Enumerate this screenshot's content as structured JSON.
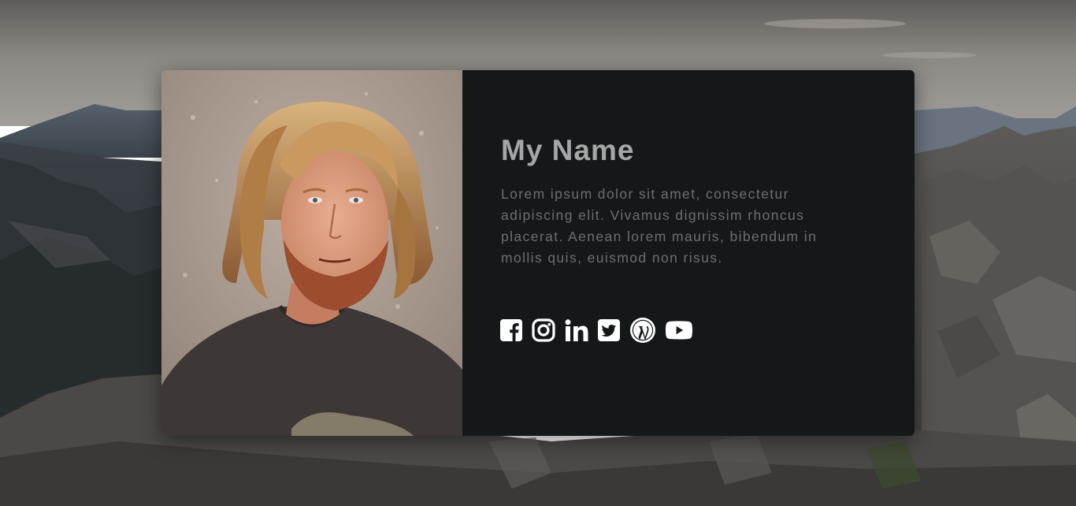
{
  "colors": {
    "card_background": "#151819",
    "name_color": "#a6a6a6",
    "bio_color": "#6e6e6e",
    "icon_color": "#ffffff"
  },
  "profile": {
    "name": "My Name",
    "bio": "Lorem ipsum dolor sit amet, consectetur adipiscing elit. Vivamus dignissim rhoncus placerat. Aenean lorem mauris, bibendum in mollis quis, euismod non risus."
  },
  "socials": [
    {
      "icon": "facebook-square-icon"
    },
    {
      "icon": "instagram-icon"
    },
    {
      "icon": "linkedin-icon"
    },
    {
      "icon": "twitter-square-icon"
    },
    {
      "icon": "wordpress-icon"
    },
    {
      "icon": "youtube-icon"
    }
  ]
}
